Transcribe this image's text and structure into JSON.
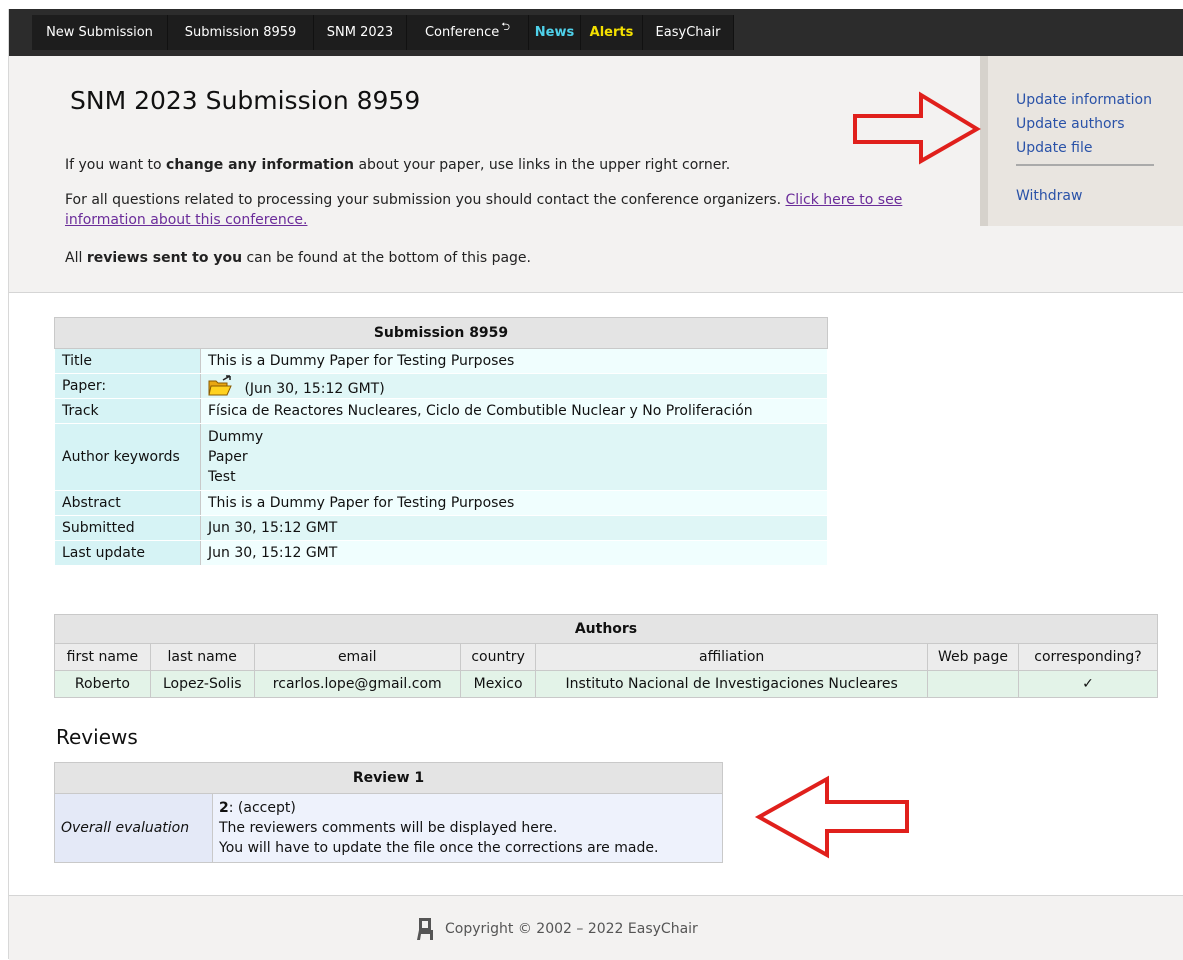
{
  "nav": {
    "items": [
      "New Submission",
      "Submission 8959",
      "SNM 2023",
      "Conference",
      "News",
      "Alerts",
      "EasyChair"
    ],
    "conference_mark": "⮌"
  },
  "header": {
    "title": "SNM 2023 Submission 8959",
    "para1_pre": "If you want to ",
    "para1_bold": "change any information",
    "para1_post": " about your paper, use links in the upper right corner.",
    "para2_pre": "For all questions related to processing your submission you should contact the conference organizers. ",
    "para2_link": "Click here to see information about this conference.",
    "para3_pre": "All ",
    "para3_bold": "reviews sent to you",
    "para3_post": " can be found at the bottom of this page."
  },
  "right_menu": {
    "update_information": "Update information",
    "update_authors": "Update authors",
    "update_file": "Update file",
    "withdraw": "Withdraw"
  },
  "submission": {
    "heading": "Submission 8959",
    "rows": [
      {
        "label": "Title",
        "value": "This is a Dummy Paper for Testing Purposes"
      },
      {
        "label": "Paper:",
        "value": "(Jun 30, 15:12 GMT)"
      },
      {
        "label": "Track",
        "value": "Física de Reactores Nucleares, Ciclo de Combutible Nuclear y No Proliferación"
      },
      {
        "label": "Author keywords",
        "keywords": [
          "Dummy",
          "Paper",
          "Test"
        ]
      },
      {
        "label": "Abstract",
        "value": "This is a Dummy Paper for Testing Purposes"
      },
      {
        "label": "Submitted",
        "value": "Jun 30, 15:12 GMT"
      },
      {
        "label": "Last update",
        "value": "Jun 30, 15:12 GMT"
      }
    ]
  },
  "authors": {
    "heading": "Authors",
    "columns": [
      "first name",
      "last name",
      "email",
      "country",
      "affiliation",
      "Web page",
      "corresponding?"
    ],
    "rows": [
      [
        "Roberto",
        "Lopez-Solis",
        "rcarlos.lope@gmail.com",
        "Mexico",
        "Instituto Nacional de Investigaciones Nucleares",
        "",
        "✓"
      ]
    ]
  },
  "reviews": {
    "heading": "Reviews",
    "review_title": "Review 1",
    "label": "Overall evaluation",
    "score": "2",
    "score_text": ": (accept)",
    "line2": "The reviewers comments will be displayed here.",
    "line3": "You will have to update the file once the corrections are made."
  },
  "footer": {
    "copyright": "Copyright © 2002 – 2022 EasyChair"
  },
  "colors": {
    "nav_bg": "#2c2c2c",
    "news": "#4fd1ea",
    "alerts": "#f4e000",
    "link": "#2a52a8",
    "arrow": "#e0201c"
  }
}
